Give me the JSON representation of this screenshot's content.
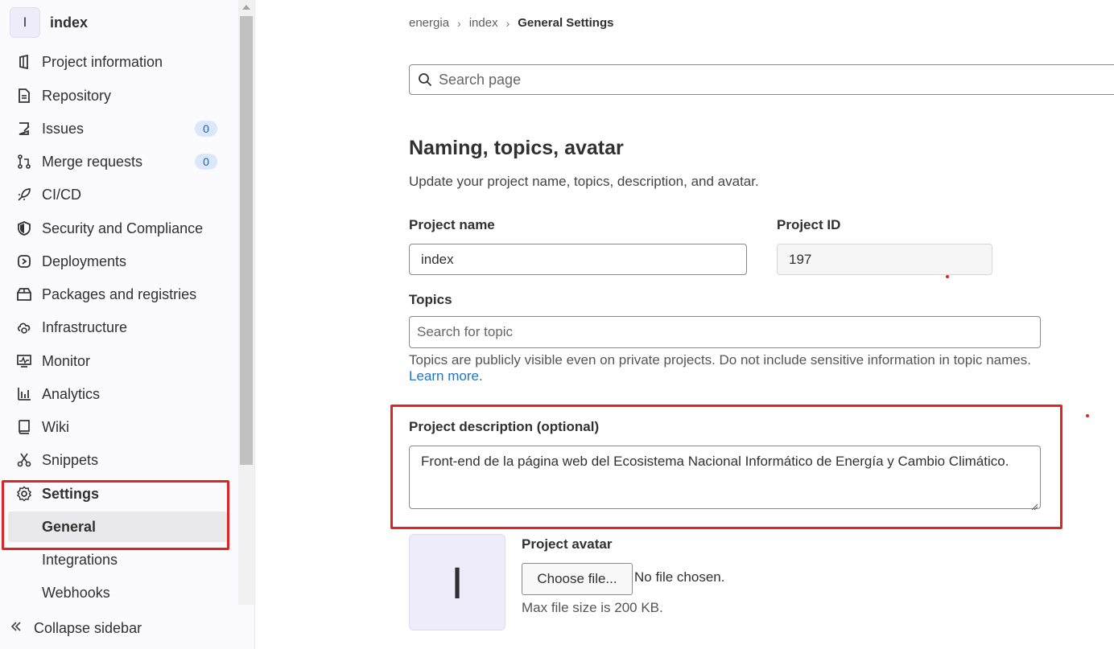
{
  "project": {
    "avatar_letter": "I",
    "name": "index"
  },
  "sidebar": {
    "items": [
      {
        "label": "Project information",
        "icon": "project-info-icon"
      },
      {
        "label": "Repository",
        "icon": "document-icon"
      },
      {
        "label": "Issues",
        "icon": "issues-icon",
        "badge": "0"
      },
      {
        "label": "Merge requests",
        "icon": "merge-request-icon",
        "badge": "0"
      },
      {
        "label": "CI/CD",
        "icon": "rocket-icon"
      },
      {
        "label": "Security and Compliance",
        "icon": "shield-icon"
      },
      {
        "label": "Deployments",
        "icon": "deployments-icon"
      },
      {
        "label": "Packages and registries",
        "icon": "package-icon"
      },
      {
        "label": "Infrastructure",
        "icon": "cloud-gear-icon"
      },
      {
        "label": "Monitor",
        "icon": "monitor-icon"
      },
      {
        "label": "Analytics",
        "icon": "chart-icon"
      },
      {
        "label": "Wiki",
        "icon": "book-icon"
      },
      {
        "label": "Snippets",
        "icon": "scissors-icon"
      },
      {
        "label": "Settings",
        "icon": "gear-icon"
      }
    ],
    "sub_items": [
      "General",
      "Integrations",
      "Webhooks"
    ],
    "collapse_label": "Collapse sidebar"
  },
  "breadcrumb": {
    "items": [
      "energia",
      "index"
    ],
    "current": "General Settings"
  },
  "search": {
    "placeholder": "Search page"
  },
  "section": {
    "title": "Naming, topics, avatar",
    "description": "Update your project name, topics, description, and avatar."
  },
  "form": {
    "project_name_label": "Project name",
    "project_name_value": "index",
    "project_id_label": "Project ID",
    "project_id_value": "197",
    "topics_label": "Topics",
    "topics_placeholder": "Search for topic",
    "topics_help": "Topics are publicly visible even on private projects. Do not include sensitive information in topic names.",
    "topics_help_link": "Learn more",
    "description_label": "Project description (optional)",
    "description_value": "Front-end de la página web del Ecosistema Nacional Informático de Energía y Cambio Climático.",
    "avatar_label": "Project avatar",
    "avatar_letter": "I",
    "choose_file_label": "Choose file...",
    "file_status": "No file chosen.",
    "max_size": "Max file size is 200 KB."
  },
  "colors": {
    "highlight": "#e02424",
    "badge_bg": "#dbe8fb",
    "link": "#1f75cb"
  }
}
